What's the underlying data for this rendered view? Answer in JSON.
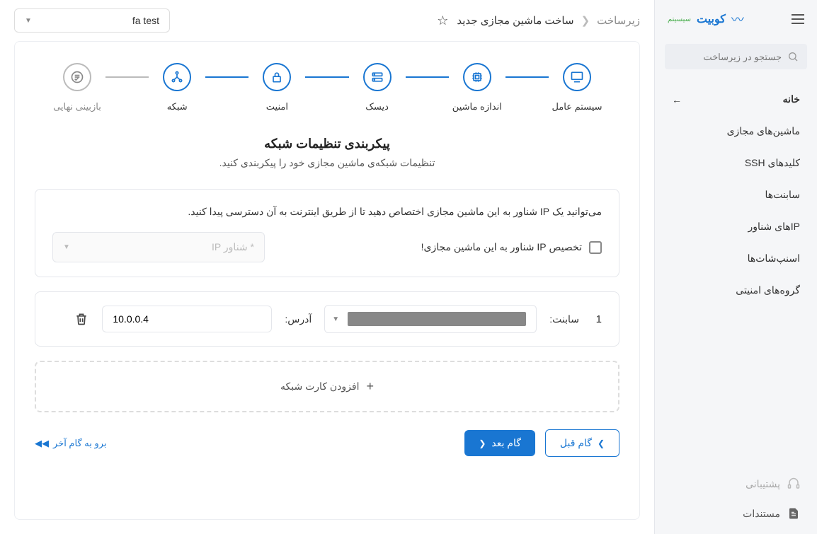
{
  "brand": {
    "name": "کوبیت",
    "sub": "سیسیتم"
  },
  "search": {
    "placeholder": "جستجو در زیرساخت"
  },
  "nav": {
    "items": [
      {
        "label": "خانه",
        "active": true
      },
      {
        "label": "ماشین‌های مجازی"
      },
      {
        "label": "کلیدهای SSH"
      },
      {
        "label": "سابنت‌ها"
      },
      {
        "label": "IPهای شناور"
      },
      {
        "label": "اسنپ‌شات‌ها"
      },
      {
        "label": "گروه‌های امنیتی"
      }
    ]
  },
  "footer": {
    "support": "پشتیبانی",
    "docs": "مستندات"
  },
  "breadcrumb": {
    "parent": "زیرساخت",
    "current": "ساخت ماشین مجازی جدید"
  },
  "project": {
    "selected": "fa test"
  },
  "stepper": {
    "steps": [
      {
        "label": "سیستم عامل"
      },
      {
        "label": "اندازه ماشین"
      },
      {
        "label": "دیسک"
      },
      {
        "label": "امنیت"
      },
      {
        "label": "شبکه"
      },
      {
        "label": "بازبینی نهایی"
      }
    ]
  },
  "section": {
    "title": "پیکربندی تنظیمات شبکه",
    "desc": "تنظیمات شبکه‌ی ماشین مجازی خود را پیکربندی کنید."
  },
  "floating_ip": {
    "info": "می‌توانید یک IP شناور به این ماشین مجازی اختصاص دهید تا از طریق اینترنت به آن دسترسی پیدا کنید.",
    "checkbox_label": "تخصیص IP شناور به این ماشین مجازی!",
    "select_placeholder": "IP شناور *"
  },
  "nic": {
    "index": "1",
    "subnet_label": "سابنت:",
    "address_label": "آدرس:",
    "address_value": "10.0.0.4"
  },
  "add_card": "افزودن کارت شبکه",
  "actions": {
    "prev": "گام قبل",
    "next": "گام بعد",
    "last": "برو به گام آخر"
  }
}
